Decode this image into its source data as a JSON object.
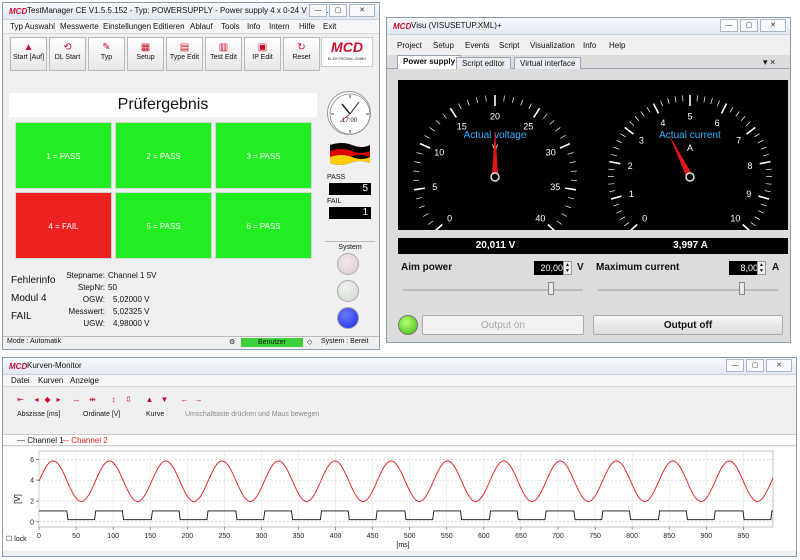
{
  "testmanager": {
    "title": "TestManager CE  V1.5.5.152 - Typ: POWERSUPPLY - Power supply 4 x 0-24 V - MC...",
    "menu": [
      "Typ Auswahl",
      "Messwerte",
      "Einstellungen",
      "Editieren",
      "Ablauf",
      "Tools",
      "Info",
      "Intern",
      "Hilfe",
      "Exit"
    ],
    "toolbar": [
      {
        "label": "Start [Auf]",
        "icon": "arrow-up-icon"
      },
      {
        "label": "DL Start",
        "icon": "dl-start-icon"
      },
      {
        "label": "Typ",
        "icon": "typ-icon"
      },
      {
        "label": "Setup",
        "icon": "setup-icon"
      },
      {
        "label": "Type Edit",
        "icon": "type-edit-icon"
      },
      {
        "label": "Test Edit",
        "icon": "test-edit-icon"
      },
      {
        "label": "IP Edit",
        "icon": "ip-edit-icon"
      },
      {
        "label": "Reset",
        "icon": "reset-icon"
      }
    ],
    "brand": {
      "name": "MCD",
      "sub": "ELEKTRONIK GMBH"
    },
    "heading": "Prüfergebnis",
    "results": [
      "1 = PASS",
      "2 = PASS",
      "3 = PASS",
      "4 = FAIL",
      "5 = PASS",
      "6 = PASS"
    ],
    "colors": {
      "pass": "#21ee21",
      "fail": "#ee2121"
    },
    "fehlerinfo": {
      "label": "Fehlerinfo",
      "modul": "Modul 4",
      "status": "FAIL",
      "stepname_label": "Stepname:",
      "stepname": "Channel 1 5V",
      "stepnr_label": "StepNr:",
      "stepnr": "50",
      "ogw_label": "OGW:",
      "ogw": "5,02000 V",
      "messwert_label": "Messwert:",
      "messwert": "5,02325 V",
      "ugw_label": "UGW:",
      "ugw": "4,98000 V"
    },
    "clock_text": "17:00",
    "pass_label": "PASS",
    "pass_count": "5",
    "fail_label": "FAIL",
    "fail_count": "1",
    "system_label": "System",
    "status": {
      "mode": "Mode : Automatik",
      "user": "Benutzer",
      "system": "System : Bereit"
    }
  },
  "visu": {
    "title": "Visu (VISUSETUP.XML)+",
    "menu": [
      "Project",
      "Setup",
      "Events",
      "Script",
      "Visualization",
      "Info",
      "Help"
    ],
    "tabs": [
      "Power supply",
      "Script editor",
      "Virtual interface"
    ],
    "active_tab": 0,
    "close_label": "▾  ×",
    "voltage": {
      "label": "Actual voltage",
      "unit_symbol": "V",
      "min": 0,
      "max": 40,
      "ticks": [
        "0",
        "5",
        "10",
        "15",
        "20",
        "25",
        "30",
        "35",
        "40"
      ],
      "value": 20.011,
      "readout": "20,011 V"
    },
    "current": {
      "label": "Actual current",
      "unit_symbol": "A",
      "min": 0,
      "max": 10,
      "ticks": [
        "0",
        "1",
        "2",
        "3",
        "4",
        "5",
        "6",
        "7",
        "8",
        "9",
        "10"
      ],
      "value": 3.997,
      "readout": "3,997 A"
    },
    "aim_power": {
      "label": "Aim power",
      "value": "20,000",
      "unit": "V",
      "slider_fraction": 0.82
    },
    "max_current": {
      "label": "Maximum current",
      "value": "8,000",
      "unit": "A",
      "slider_fraction": 0.8
    },
    "output_on": "Output on",
    "output_off": "Output off"
  },
  "kurven": {
    "title": "Kurven-Monitor",
    "menu": [
      "Datei",
      "Kurven",
      "Anzeige"
    ],
    "header": {
      "abszisse": "Abszisse [ms]",
      "ordinate": "Ordinate [V]",
      "kurve": "Kurve",
      "hint": "Umschalttaste drücken und Maus bewegen"
    },
    "legend": [
      {
        "name": "Channel 1",
        "color": "#111111"
      },
      {
        "name": "Channel 2",
        "color": "#e01818"
      }
    ],
    "lock_label": "lock"
  },
  "chart_data": {
    "type": "line",
    "xlabel": "[ms]",
    "ylabel": "[V]",
    "xlim": [
      0,
      990
    ],
    "ylim": [
      -0.5,
      6.8
    ],
    "xticks": [
      "0",
      "50",
      "100",
      "150",
      "200",
      "250",
      "300",
      "350",
      "400",
      "450",
      "500",
      "550",
      "600",
      "650",
      "700",
      "750",
      "800",
      "850",
      "900",
      "950"
    ],
    "yticks": [
      "0",
      "2",
      "4",
      "6"
    ],
    "grid": true,
    "series": [
      {
        "name": "Channel 2",
        "color": "#e01818",
        "kind": "sine",
        "offset": 3.9,
        "amplitude": 1.95,
        "period_ms": 76
      },
      {
        "name": "Channel 1",
        "color": "#111111",
        "kind": "square",
        "low": 0.2,
        "high": 1.05,
        "period_ms": 76
      }
    ]
  }
}
